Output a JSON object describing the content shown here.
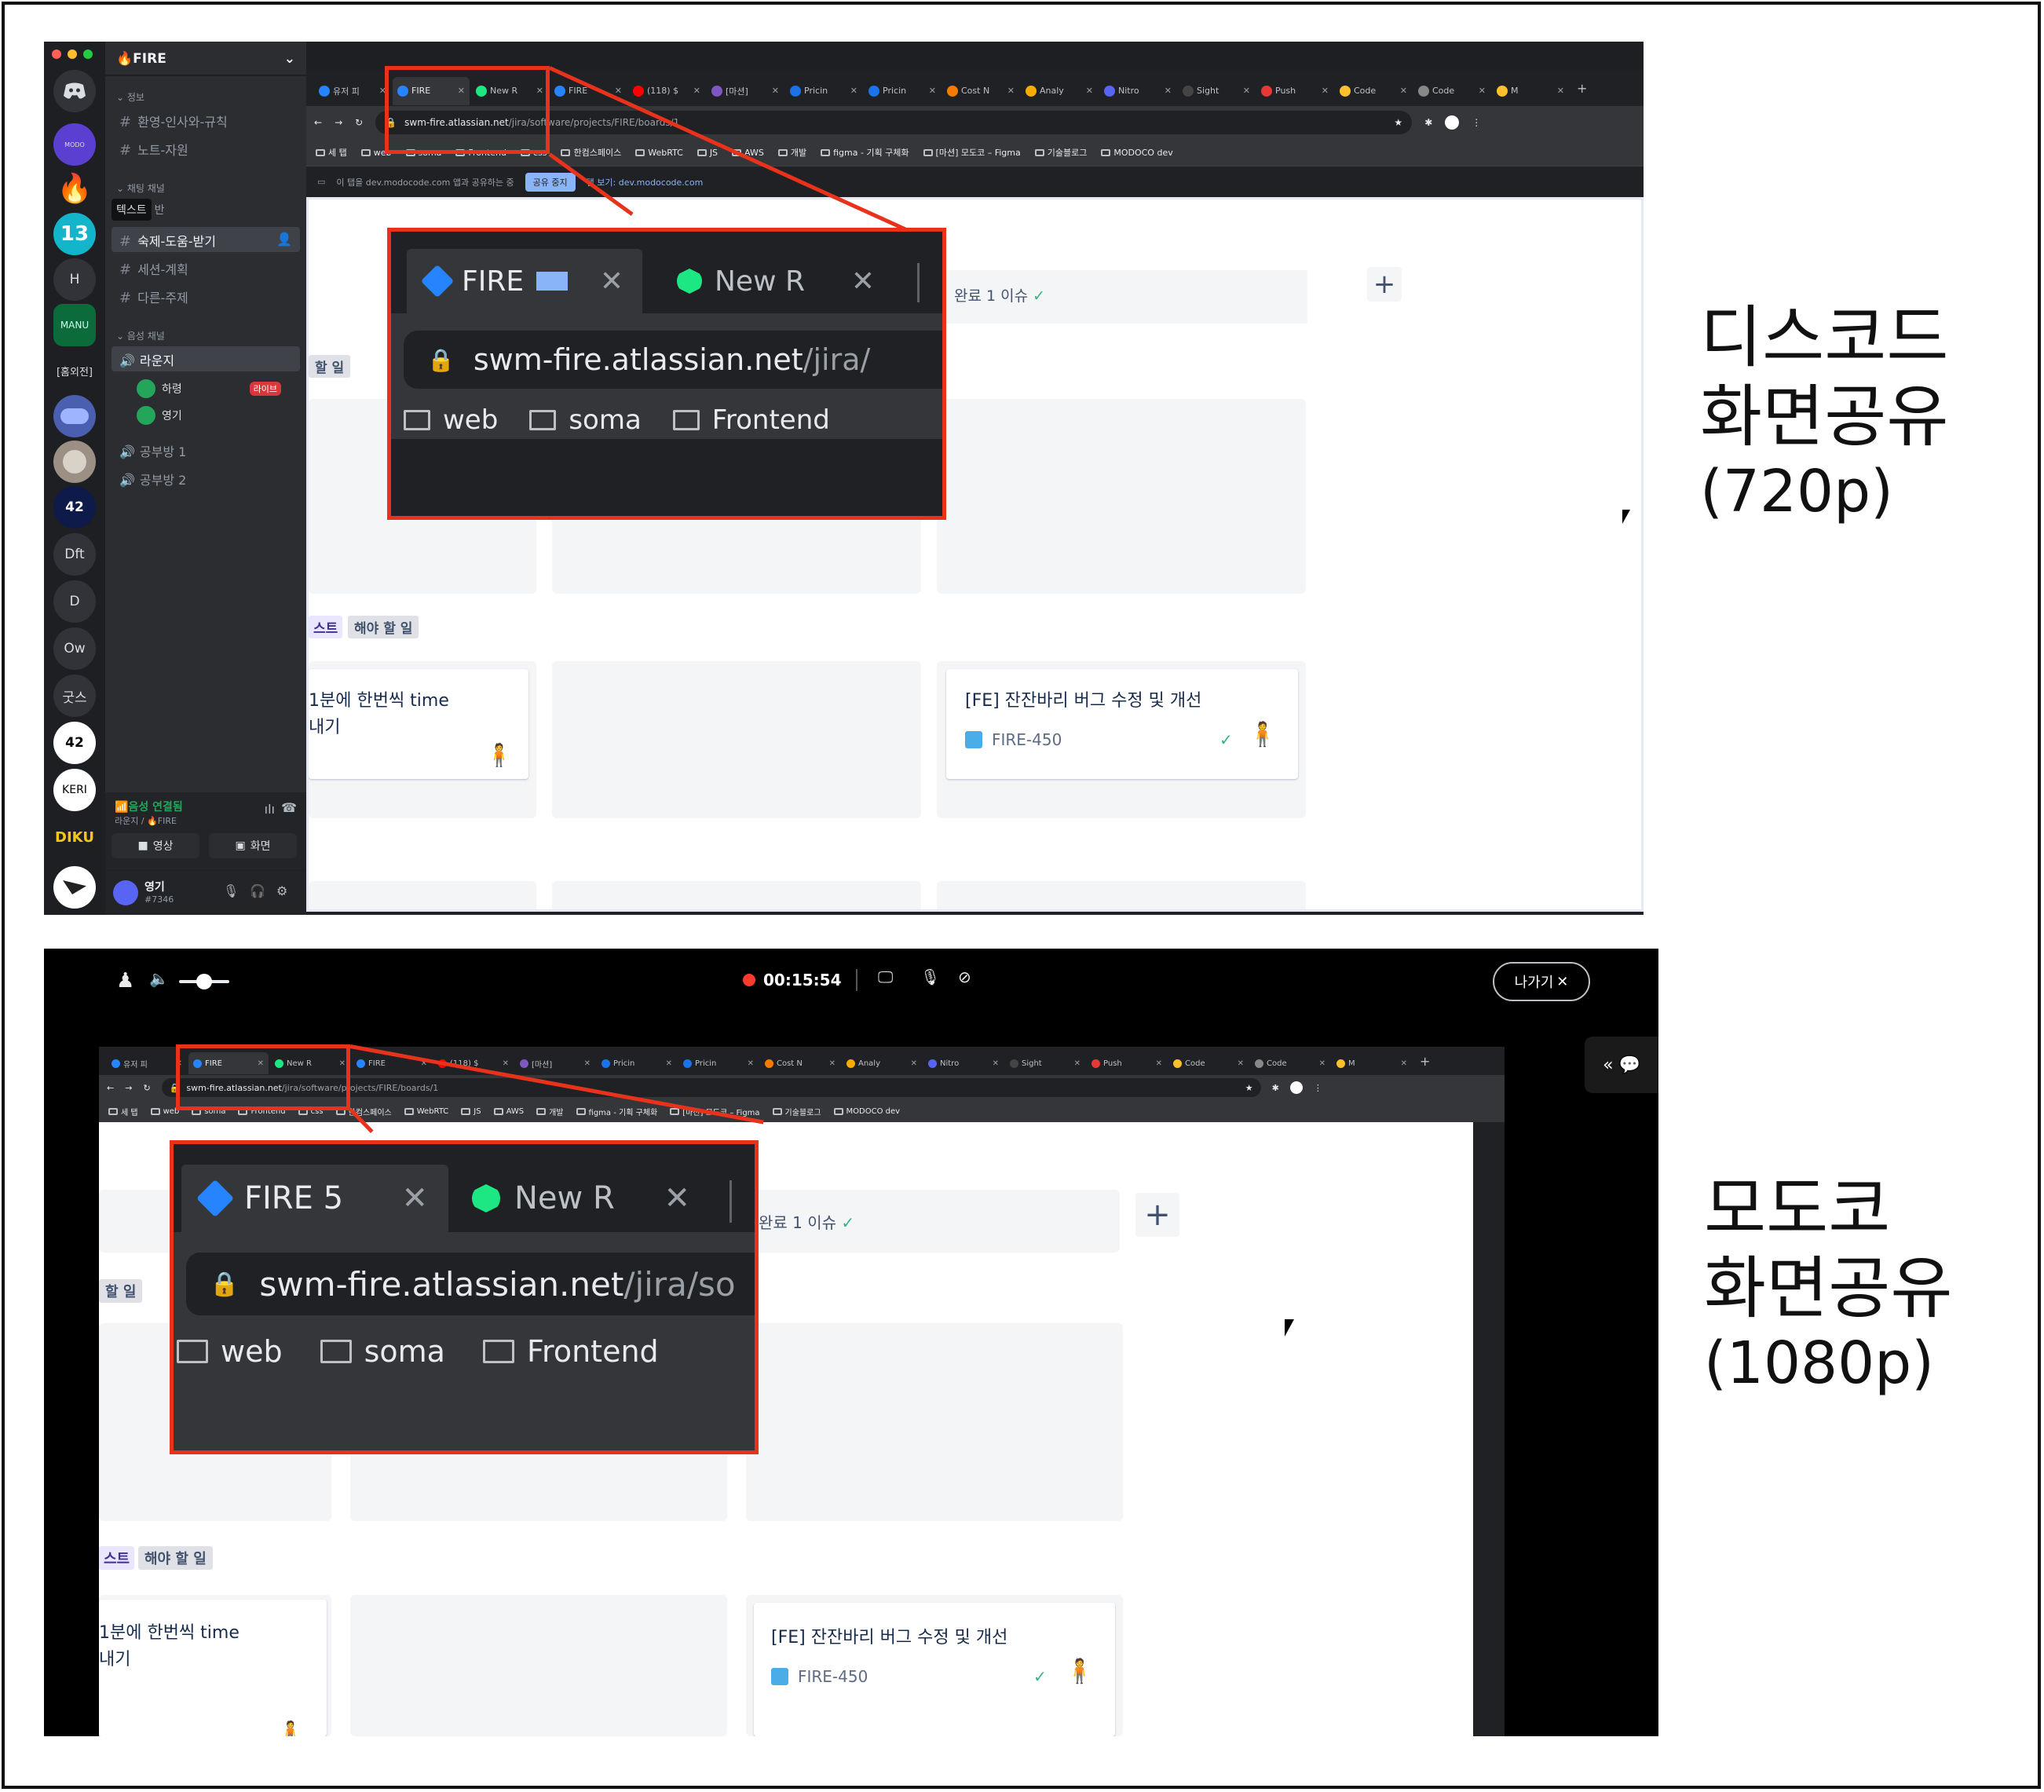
{
  "captions": {
    "top": [
      "디스코드",
      "화면공유",
      "(720p)"
    ],
    "bottom": [
      "모도코",
      "화면공유",
      "(1080p)"
    ]
  },
  "discord": {
    "server_name": "FIRE",
    "servers": [
      "13",
      "H",
      "MANU",
      "[홈외전]",
      "42",
      "Dft",
      "D",
      "Ow",
      "굿스",
      "42",
      "KERI",
      "DIKU"
    ],
    "category_info": "정보",
    "info_channels": [
      "환영-인사와-규칙",
      "노트-자원"
    ],
    "category_chat": "채팅 채널",
    "tooltip": "텍스트",
    "tooltip_after": "반",
    "chat_channels": [
      "숙제-도움-받기",
      "세션-계획",
      "다른-주제"
    ],
    "category_voice": "음성 채널",
    "voice_channels": [
      "라운지",
      "공부방 1",
      "공부방 2"
    ],
    "voice_users": [
      {
        "name": "하령",
        "badge": "라이브"
      },
      {
        "name": "영기",
        "badge": ""
      }
    ],
    "voice_status": "음성 연결됨",
    "voice_location": "라운지 / 🔥FIRE",
    "video_button": "영상",
    "screen_button": "화면",
    "user_name": "영기",
    "user_tag": "#7346"
  },
  "browser": {
    "tabs": [
      "유저 피",
      "FIRE",
      "New R",
      "FIRE",
      "(118) $",
      "[마션]",
      "Pricin",
      "Pricin",
      "Cost N",
      "Analy",
      "Nitro",
      "Sight",
      "Push",
      "Code",
      "Code",
      "M"
    ],
    "url_host": "swm-fire.atlassian.net",
    "url_path": "/jira/software/projects/FIRE/boards/1",
    "bookmarks": [
      "세 탭",
      "web",
      "soma",
      "Frontend",
      "css",
      "한컴스페이스",
      "WebRTC",
      "JS",
      "AWS",
      "개발",
      "figma - 기획 구체화",
      "[마션] 모도코 – Figma",
      "기술블로그",
      "MODOCO dev"
    ],
    "share_info": "이 탭을 dev.modocode.com 앱과 공유하는 중",
    "share_stop": "공유 중지",
    "share_view": "탭 보기: dev.modocode.com"
  },
  "zoom_top": {
    "tab1": "FIRE",
    "tab2": "New R",
    "url_host": "swm-fire.atlassian.net",
    "url_path": "/jira/",
    "bookmarks": [
      "web",
      "soma",
      "Frontend"
    ]
  },
  "zoom_bottom": {
    "tab1": "FIRE 5",
    "tab2": "New R",
    "url_host": "swm-fire.atlassian.net",
    "url_path": "/jira/so",
    "bookmarks": [
      "web",
      "soma",
      "Frontend"
    ]
  },
  "jira": {
    "done_summary": "완료 1 이슈",
    "todo_chip": "할 일",
    "test_chip": "스트",
    "todo_chip2": "해야 할 일",
    "card1_line1": "1분에 한번씩 time",
    "card1_line2": "내기",
    "card2_title": "[FE] 잔잔바리 버그 수정 및 개선",
    "card2_key": "FIRE-450"
  },
  "modoco": {
    "timer": "00:15:54",
    "leave_button": "나가기",
    "side_panel_icon": "« 💬"
  },
  "colors": {
    "highlight": "#e8321c",
    "discord_bg": "#1e1f22",
    "chrome_bg": "#202124",
    "jira_blue": "#0052cc",
    "done_green": "#36b37e"
  }
}
